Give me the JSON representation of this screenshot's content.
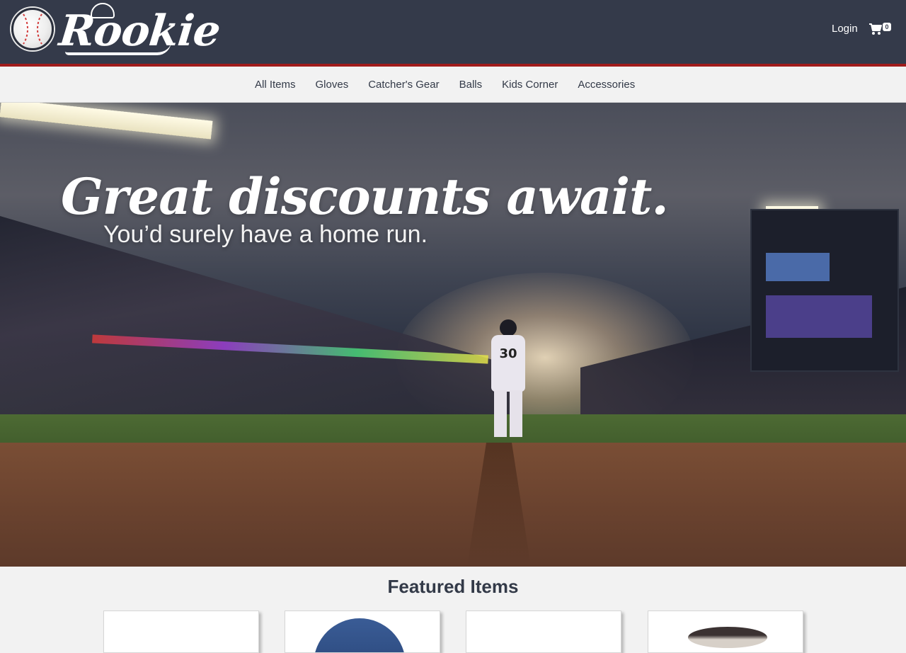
{
  "header": {
    "brand": "Rookie",
    "login_label": "Login",
    "cart_count": "0"
  },
  "nav": {
    "items": [
      "All Items",
      "Gloves",
      "Catcher's Gear",
      "Balls",
      "Kids Corner",
      "Accessories"
    ]
  },
  "hero": {
    "title": "Great discounts await.",
    "subtitle": "You’d surely have a home run.",
    "player_number": "30"
  },
  "featured": {
    "title": "Featured Items"
  },
  "colors": {
    "topbar": "#343a4a",
    "accent_red": "#a01c1c",
    "nav_bg": "#f2f2f2",
    "text_dark": "#333a48"
  }
}
